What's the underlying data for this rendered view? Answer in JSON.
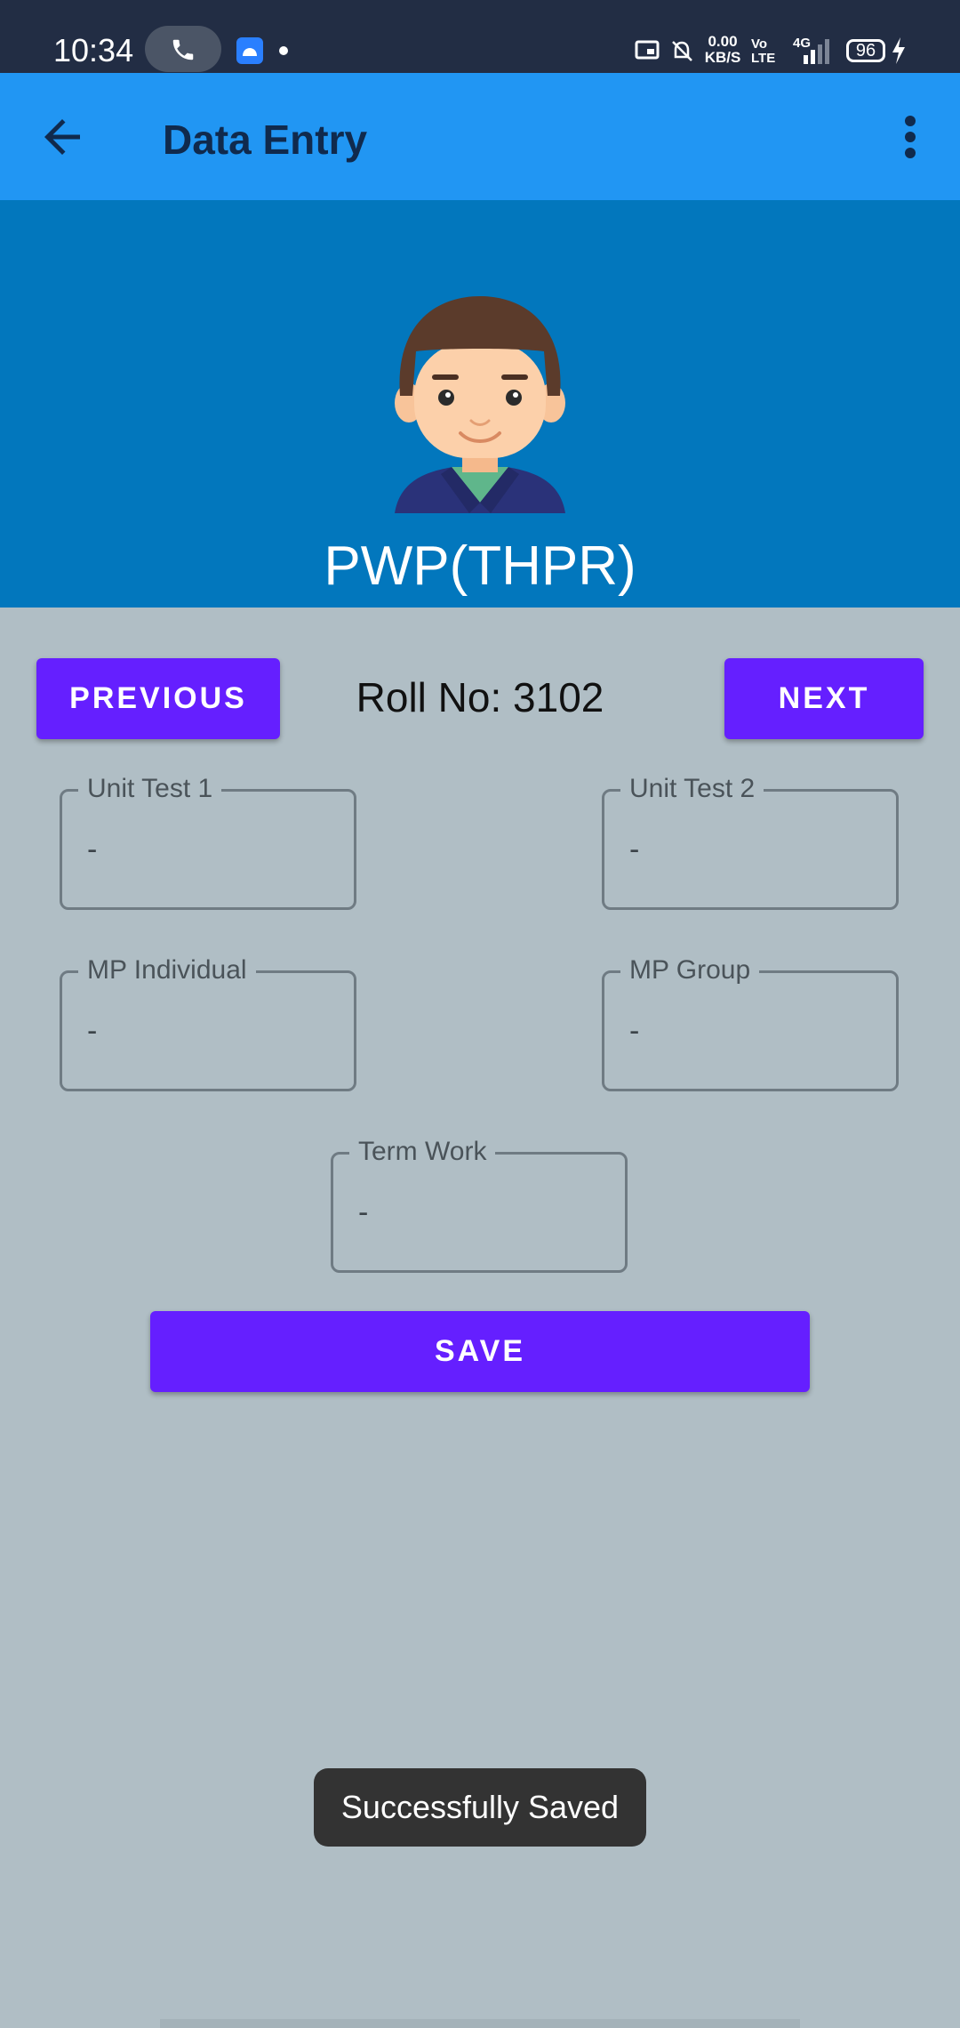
{
  "status_bar": {
    "time": "10:34",
    "net_speed_value": "0.00",
    "net_speed_unit": "KB/S",
    "volte_top": "Vo",
    "volte_bottom": "LTE",
    "network": "4G",
    "battery": "96",
    "icons": [
      "phone-call-icon",
      "android-app-icon",
      "cast-icon",
      "mute-icon",
      "signal-icon",
      "charging-icon"
    ]
  },
  "app_bar": {
    "title": "Data Entry",
    "icons": [
      "back-arrow-icon",
      "more-vert-icon"
    ]
  },
  "header": {
    "class_name": "PWP(THPR)"
  },
  "navigation": {
    "previous_label": "PREVIOUS",
    "roll_label": "Roll No: 3102",
    "next_label": "NEXT"
  },
  "fields": {
    "unit_test_1": {
      "label": "Unit Test 1",
      "value": "-"
    },
    "unit_test_2": {
      "label": "Unit Test 2",
      "value": "-"
    },
    "mp_individual": {
      "label": "MP Individual",
      "value": "-"
    },
    "mp_group": {
      "label": "MP Group",
      "value": "-"
    },
    "term_work": {
      "label": "Term Work",
      "value": "-"
    }
  },
  "save_label": "SAVE",
  "toast": "Successfully Saved",
  "colors": {
    "status_bar": "#222d44",
    "app_bar": "#2196f3",
    "header": "#0277bd",
    "background": "#b0bec5",
    "accent_button": "#651fff",
    "toast": "#333333"
  }
}
